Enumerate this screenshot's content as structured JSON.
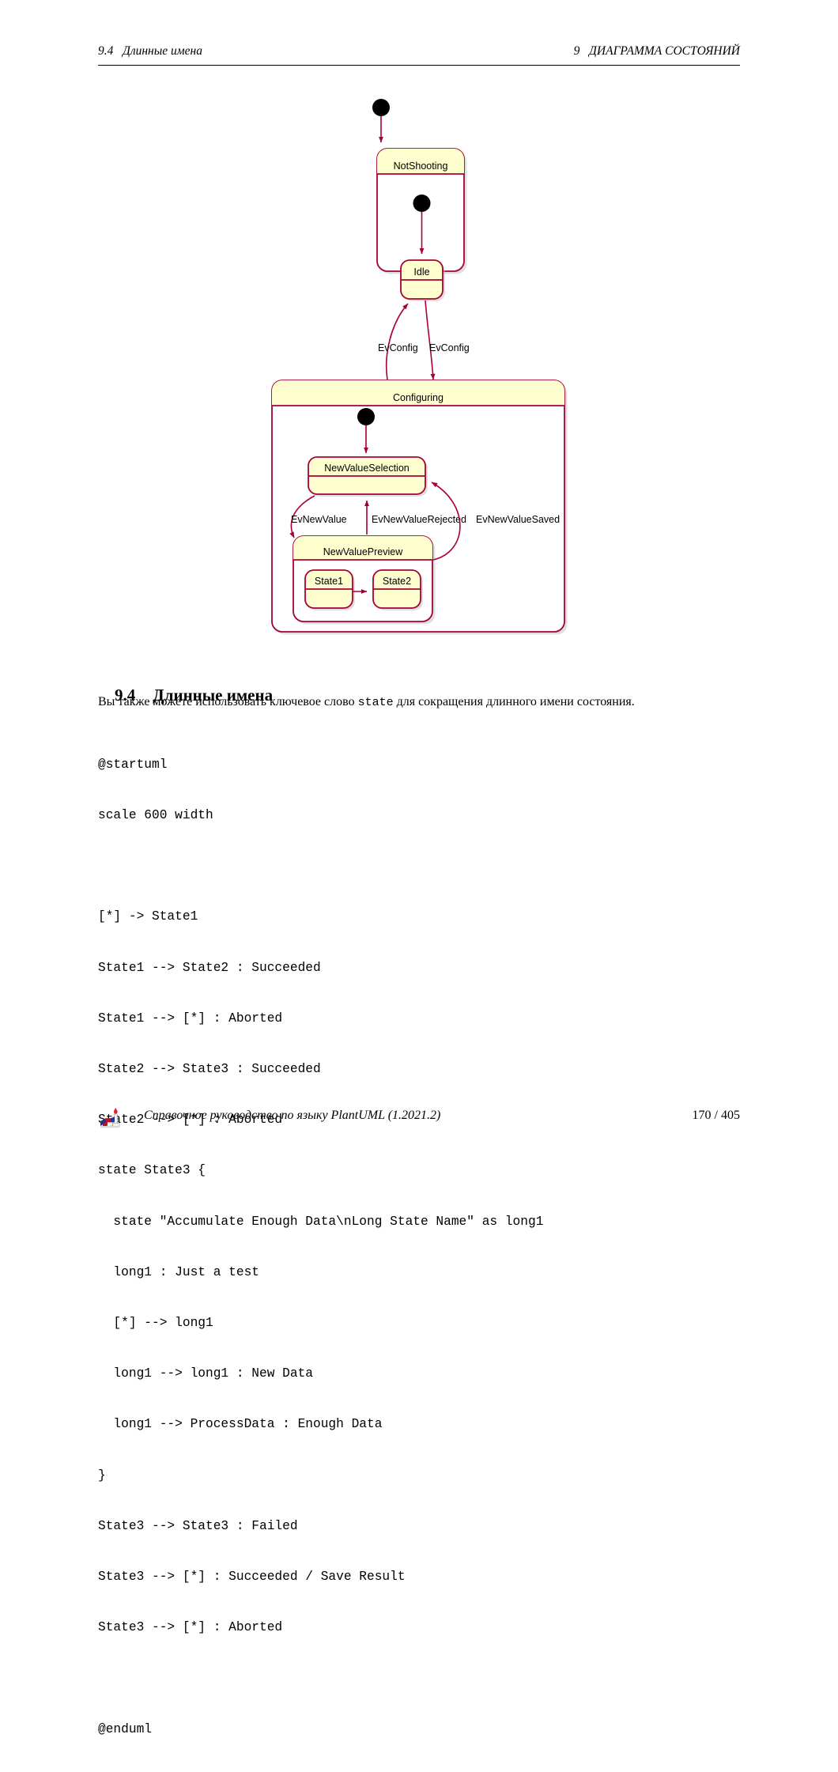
{
  "header": {
    "left": "9.4   Длинные имена",
    "right": "9   ДИАГРАММА СОСТОЯНИЙ"
  },
  "diagram": {
    "title": "state-diagram-composite",
    "colors": {
      "state_border": "#A80036",
      "state_header_fill": "#FEFECE",
      "composite_body_fill": "#FFFFFF",
      "leaf_body_fill": "#FEFECE",
      "arrow": "#A80036",
      "start_node": "#000000",
      "shadow": "#BBBBBB"
    },
    "states": [
      {
        "id": "NotShooting",
        "label": "NotShooting",
        "kind": "composite"
      },
      {
        "id": "Idle",
        "label": "Idle",
        "kind": "leaf"
      },
      {
        "id": "Configuring",
        "label": "Configuring",
        "kind": "composite"
      },
      {
        "id": "NewValueSelection",
        "label": "NewValueSelection",
        "kind": "leaf"
      },
      {
        "id": "NewValuePreview",
        "label": "NewValuePreview",
        "kind": "composite"
      },
      {
        "id": "State1",
        "label": "State1",
        "kind": "leaf"
      },
      {
        "id": "State2",
        "label": "State2",
        "kind": "leaf"
      }
    ],
    "transition_labels": {
      "ev_config_out": "EvConfig",
      "ev_config_in": "EvConfig",
      "ev_new_value": "EvNewValue",
      "ev_new_value_rejected": "EvNewValueRejected",
      "ev_new_value_saved": "EvNewValueSaved"
    }
  },
  "section": {
    "number": "9.4",
    "title": "Длинные имена"
  },
  "paragraph": {
    "before": "Вы также можете использовать ключевое слово ",
    "code": "state",
    "after": " для сокращения длинного имени состояния."
  },
  "code": {
    "lines": [
      "@startuml",
      "scale 600 width",
      "",
      "[*] -> State1",
      "State1 --> State2 : Succeeded",
      "State1 --> [*] : Aborted",
      "State2 --> State3 : Succeeded",
      "State2 --> [*] : Aborted",
      "state State3 {",
      "  state \"Accumulate Enough Data\\nLong State Name\" as long1",
      "  long1 : Just a test",
      "  [*] --> long1",
      "  long1 --> long1 : New Data",
      "  long1 --> ProcessData : Enough Data",
      "}",
      "State3 --> State3 : Failed",
      "State3 --> [*] : Succeeded / Save Result",
      "State3 --> [*] : Aborted",
      "",
      "@enduml"
    ]
  },
  "footer": {
    "text": "Справочное руководство по языку PlantUML (1.2021.2)",
    "page": "170 / 405"
  }
}
